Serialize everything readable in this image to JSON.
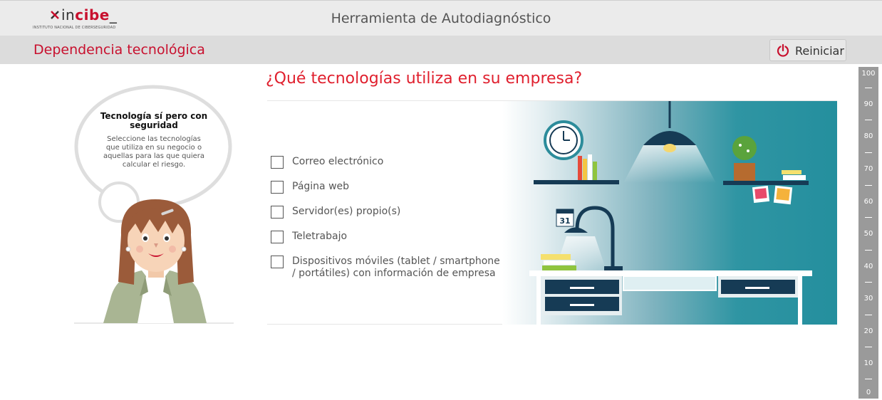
{
  "header": {
    "logo_text_prefix": "in",
    "logo_text_brand": "cibe",
    "logo_text_suffix": "_",
    "logo_subtitle": "INSTITUTO NACIONAL DE CIBERSEGURIDAD",
    "app_title": "Herramienta de Autodiagnóstico"
  },
  "subheader": {
    "section_title": "Dependencia tecnológica",
    "reset_label": "Reiniciar",
    "reset_icon": "power-icon"
  },
  "main": {
    "question": "¿Qué tecnologías utiliza en su empresa?",
    "bubble": {
      "title": "Tecnología sí pero con seguridad",
      "text": "Seleccione las tecnologías que utiliza en su negocio o aquellas para las que quiera calcular el riesgo."
    },
    "options": [
      {
        "label": "Correo electrónico",
        "checked": false
      },
      {
        "label": "Página web",
        "checked": false
      },
      {
        "label": "Servidor(es) propio(s)",
        "checked": false
      },
      {
        "label": "Teletrabajo",
        "checked": false
      },
      {
        "label": "Dispositivos móviles (tablet / smartphone / portátiles) con información de empresa",
        "checked": false
      }
    ],
    "calendar_day": "31"
  },
  "scale": {
    "labels": [
      "100",
      "90",
      "80",
      "70",
      "60",
      "50",
      "40",
      "30",
      "20",
      "10",
      "0"
    ]
  },
  "colors": {
    "brand_red": "#c8102e",
    "question_red": "#e0202e",
    "teal": "#248f9e",
    "navy": "#163b55",
    "scale_gray": "#9a9a9a"
  }
}
